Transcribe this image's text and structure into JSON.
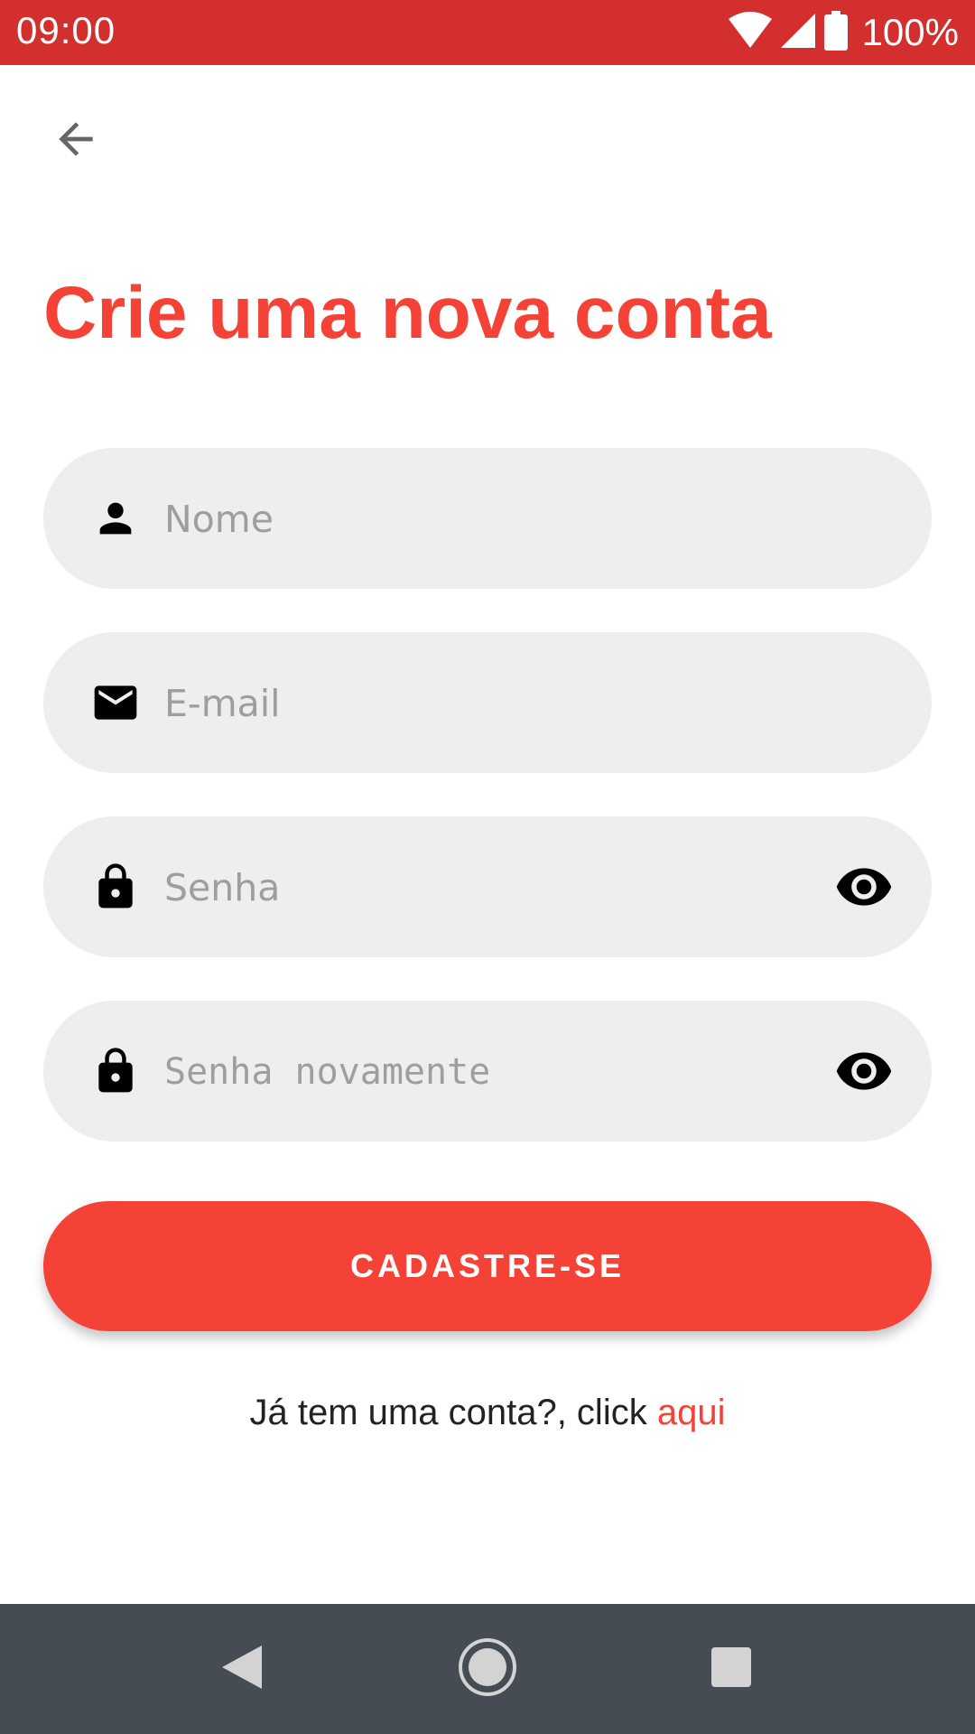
{
  "status_bar": {
    "time": "09:00",
    "battery_text": "100%",
    "icons": [
      "wifi-icon",
      "signal-icon",
      "battery-icon"
    ]
  },
  "header": {
    "back_icon": "arrow-back-icon"
  },
  "title": "Crie uma nova conta",
  "form": {
    "name": {
      "placeholder": "Nome",
      "value": "",
      "icon": "person-icon"
    },
    "email": {
      "placeholder": "E-mail",
      "value": "",
      "icon": "mail-icon"
    },
    "password": {
      "placeholder": "Senha",
      "value": "",
      "icon": "lock-icon",
      "toggle_icon": "eye-icon"
    },
    "password_confirm": {
      "placeholder": "Senha novamente",
      "value": "",
      "icon": "lock-icon",
      "toggle_icon": "eye-icon"
    }
  },
  "submit_label": "CADASTRE-SE",
  "signin": {
    "prefix": "Já tem uma conta?, click ",
    "link": "aqui"
  },
  "nav_bar": {
    "buttons": [
      "nav-back-icon",
      "nav-home-icon",
      "nav-recents-icon"
    ]
  },
  "colors": {
    "status_bar": "#d32f2f",
    "accent": "#f44336",
    "field_bg": "#eeeeee",
    "nav_bar": "#454c53"
  }
}
